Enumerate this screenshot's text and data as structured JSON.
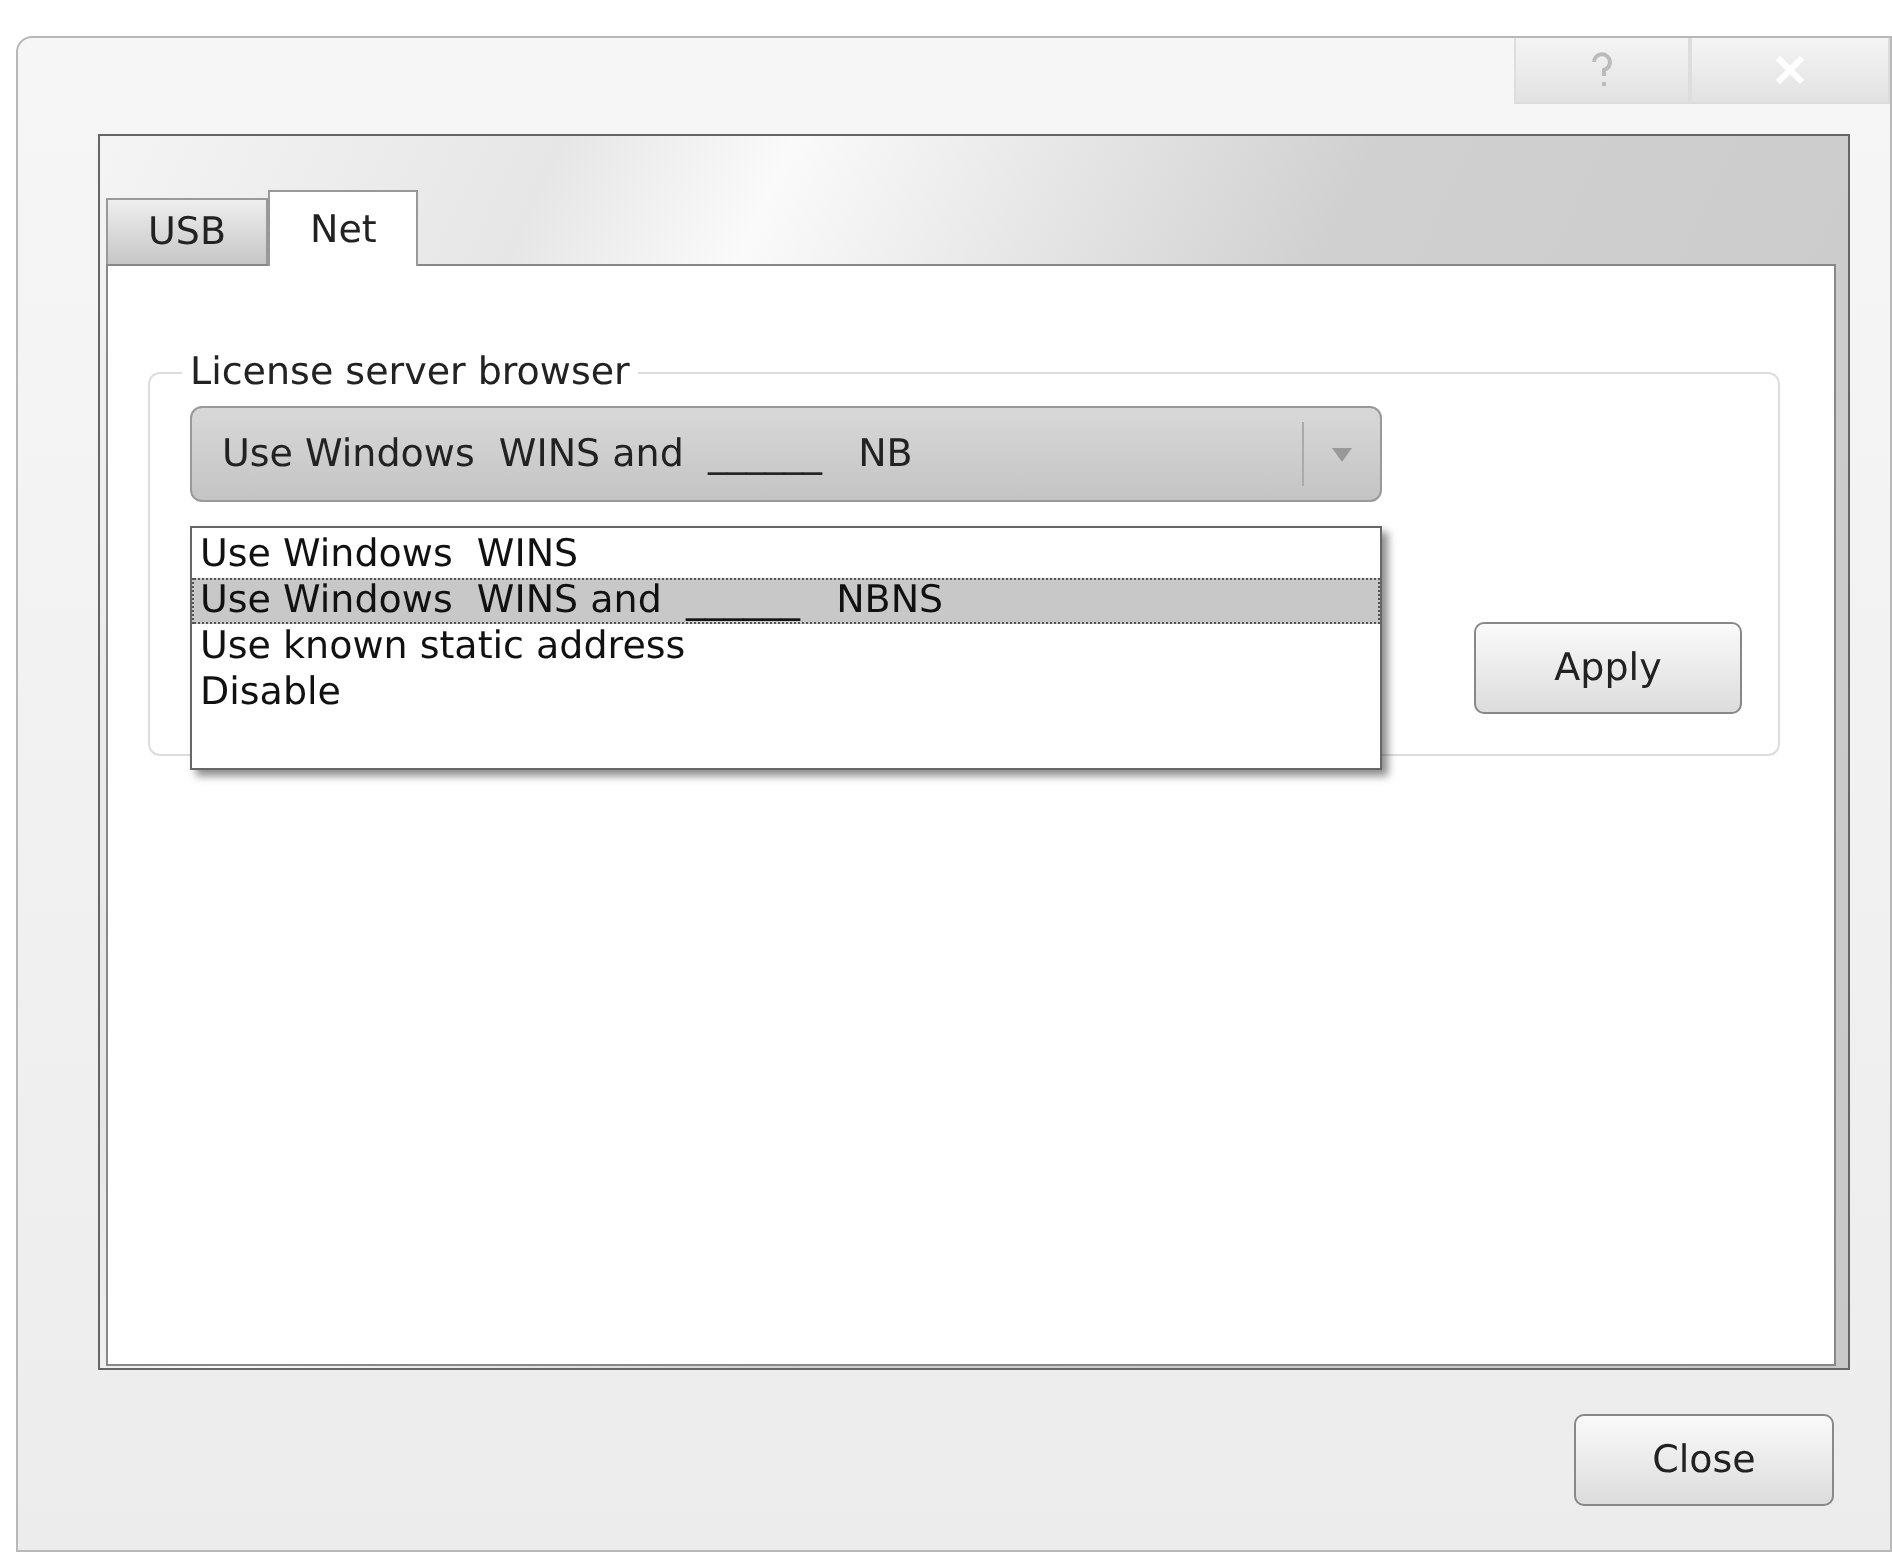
{
  "tabs": [
    {
      "label": "USB",
      "selected": false
    },
    {
      "label": "Net",
      "selected": true
    }
  ],
  "group": {
    "title": "License server browser",
    "combo": {
      "value": "Use Windows  WINS and  ______   NB",
      "expanded": true,
      "options": [
        {
          "label": "Use Windows  WINS",
          "selected": false
        },
        {
          "label": "Use Windows  WINS and  ______   NBNS",
          "selected": true
        },
        {
          "label": "Use known static address",
          "selected": false
        },
        {
          "label": "Disable",
          "selected": false
        }
      ]
    },
    "apply_button": "Apply"
  },
  "close_button": "Close"
}
